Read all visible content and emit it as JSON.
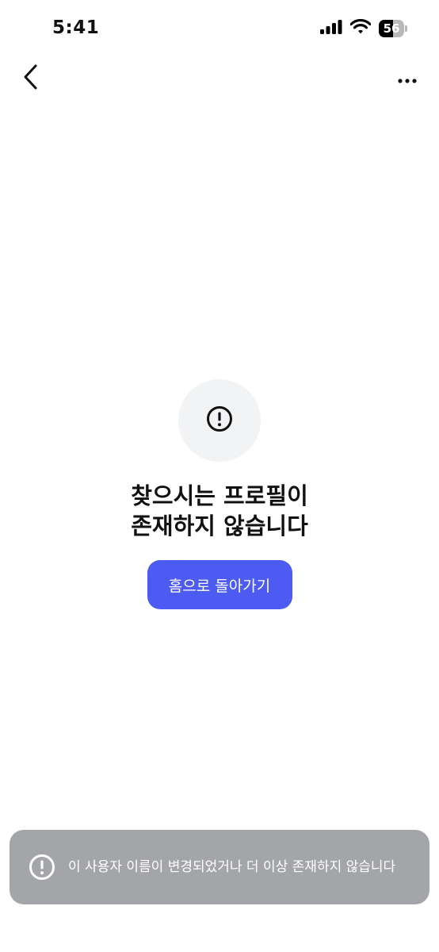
{
  "status_bar": {
    "time": "5:41",
    "battery_level": "56",
    "battery_percent": 56,
    "icons": [
      "cellular-signal-icon",
      "wifi-icon",
      "battery-icon"
    ]
  },
  "nav": {
    "back_icon": "chevron-left-icon",
    "more_icon": "more-horizontal-icon"
  },
  "empty_state": {
    "icon": "alert-circle-icon",
    "title_line1": "찾으시는 프로필이",
    "title_line2": "존재하지 않습니다",
    "button_label": "홈으로 돌아가기"
  },
  "toast": {
    "icon": "alert-circle-icon",
    "message": "이 사용자 이름이 변경되었거나 더 이상 존재하지 않습니다"
  },
  "colors": {
    "accent": "#4c5cf2",
    "toast_bg": "#a3a5a9",
    "icon_circle_bg": "#f2f3f5",
    "text": "#111111"
  }
}
